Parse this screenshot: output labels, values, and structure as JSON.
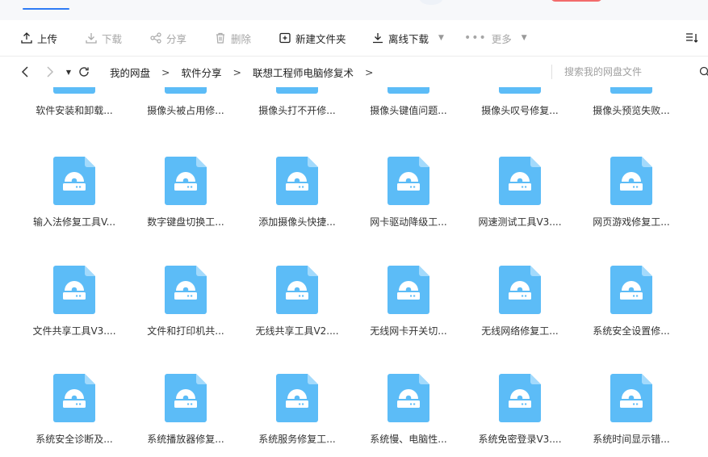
{
  "toolbar": {
    "upload": "上传",
    "download": "下载",
    "share": "分享",
    "delete": "删除",
    "new_folder": "新建文件夹",
    "offline_download": "离线下载",
    "more": "更多"
  },
  "breadcrumb": [
    "我的网盘",
    "软件分享",
    "联想工程师电脑修复术"
  ],
  "search": {
    "placeholder": "搜索我的网盘文件"
  },
  "icons": {
    "file_icon": "disc-file-icon",
    "accent_color": "#5cbcf7",
    "fold_color": "#a3dafc"
  },
  "files": [
    [
      "软件安装和卸载...",
      "摄像头被占用修...",
      "摄像头打不开修...",
      "摄像头键值问题...",
      "摄像头叹号修复...",
      "摄像头预览失败..."
    ],
    [
      "输入法修复工具V...",
      "数字键盘切换工...",
      "添加摄像头快捷...",
      "网卡驱动降级工...",
      "网速测试工具V3....",
      "网页游戏修复工..."
    ],
    [
      "文件共享工具V3....",
      "文件和打印机共...",
      "无线共享工具V2....",
      "无线网卡开关切...",
      "无线网络修复工...",
      "系统安全设置修..."
    ],
    [
      "系统安全诊断及...",
      "系统播放器修复...",
      "系统服务修复工...",
      "系统慢、电脑性...",
      "系统免密登录V3....",
      "系统时间显示错..."
    ]
  ]
}
